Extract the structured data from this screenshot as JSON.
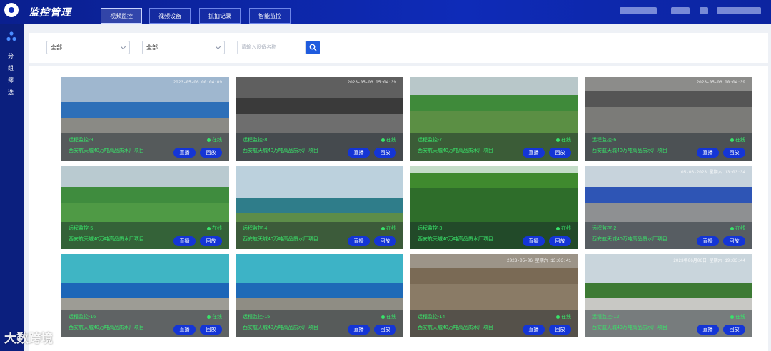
{
  "app": {
    "title": "监控管理"
  },
  "nav": {
    "tabs": [
      {
        "label": "视频监控",
        "active": true
      },
      {
        "label": "视频设备",
        "active": false
      },
      {
        "label": "抓拍记录",
        "active": false
      },
      {
        "label": "智能监控",
        "active": false
      }
    ]
  },
  "sidebar": {
    "labels": [
      "分",
      "组",
      "筛",
      "选"
    ]
  },
  "filters": {
    "select1": "全部",
    "select2": "全部",
    "search_placeholder": "请输入设备名称"
  },
  "cameras": [
    {
      "name": "远程监控-9",
      "project": "西安航天城40万吨高品质水厂项目",
      "status": "在线",
      "timestamp": "2023-05-06 00:04:09",
      "live": "直播",
      "playback": "回放"
    },
    {
      "name": "远程监控-8",
      "project": "西安航天城40万吨高品质水厂项目",
      "status": "在线",
      "timestamp": "2023-05-06 05:04:39",
      "live": "直播",
      "playback": "回放"
    },
    {
      "name": "远程监控-7",
      "project": "西安航天城40万吨高品质水厂项目",
      "status": "在线",
      "timestamp": "",
      "live": "直播",
      "playback": "回放"
    },
    {
      "name": "远程监控-6",
      "project": "西安航天城40万吨高品质水厂项目",
      "status": "在线",
      "timestamp": "2023-05-06 00:04:39",
      "live": "直播",
      "playback": "回放"
    },
    {
      "name": "远程监控-5",
      "project": "西安航天城40万吨高品质水厂项目",
      "status": "在线",
      "timestamp": "",
      "live": "直播",
      "playback": "回放"
    },
    {
      "name": "远程监控-4",
      "project": "西安航天城40万吨高品质水厂项目",
      "status": "在线",
      "timestamp": "",
      "live": "直播",
      "playback": "回放"
    },
    {
      "name": "远程监控-3",
      "project": "西安航天城40万吨高品质水厂项目",
      "status": "在线",
      "timestamp": "",
      "live": "直播",
      "playback": "回放"
    },
    {
      "name": "远程监控-2",
      "project": "西安航天城40万吨高品质水厂项目",
      "status": "在线",
      "timestamp": "05-06-2023 星期六 13:03:34",
      "live": "直播",
      "playback": "回放"
    },
    {
      "name": "远程监控-16",
      "project": "西安航天城40万吨高品质水厂项目",
      "status": "在线",
      "timestamp": "",
      "live": "直播",
      "playback": "回放"
    },
    {
      "name": "远程监控-15",
      "project": "西安航天城40万吨高品质水厂项目",
      "status": "在线",
      "timestamp": "",
      "live": "直播",
      "playback": "回放"
    },
    {
      "name": "远程监控-14",
      "project": "西安航天城40万吨高品质水厂项目",
      "status": "在线",
      "timestamp": "2023-05-06 星期六 13:03:41",
      "live": "直播",
      "playback": "回放"
    },
    {
      "name": "远程监控-13",
      "project": "西安航天城40万吨高品质水厂项目",
      "status": "在线",
      "timestamp": "2023年06月06日 星期六 19:03:44",
      "live": "直播",
      "playback": "回放"
    }
  ],
  "watermark": "大数跨境",
  "colors": {
    "header": "#0e2bb8",
    "sidebar": "#0b1f7e",
    "button": "#1435d6",
    "online": "#39e36a",
    "search": "#1f5bde"
  }
}
